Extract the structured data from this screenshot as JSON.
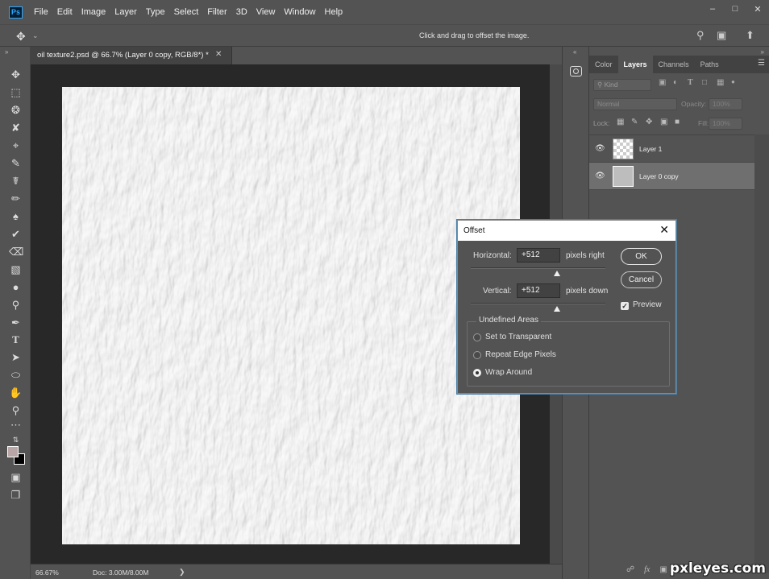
{
  "app": {
    "logo": "Ps"
  },
  "menu": [
    "File",
    "Edit",
    "Image",
    "Layer",
    "Type",
    "Select",
    "Filter",
    "3D",
    "View",
    "Window",
    "Help"
  ],
  "options_bar": {
    "hint": "Click and drag to offset the image."
  },
  "document": {
    "tab_title": "oil texture2.psd @ 66.7% (Layer 0 copy, RGB/8*) *",
    "zoom": "66.67%",
    "doc_size": "Doc: 3.00M/8.00M"
  },
  "panel": {
    "tabs": [
      "Color",
      "Layers",
      "Channels",
      "Paths"
    ],
    "active_tab": "Layers",
    "filter_kind": "Kind",
    "blend_mode": "Normal",
    "opacity_label": "Opacity:",
    "opacity_value": "100%",
    "lock_label": "Lock:",
    "fill_label": "Fill:",
    "fill_value": "100%",
    "layers": [
      {
        "name": "Layer 1",
        "visible": true,
        "selected": false,
        "thumb": "transparent"
      },
      {
        "name": "Layer 0 copy",
        "visible": true,
        "selected": true,
        "thumb": "texture"
      }
    ]
  },
  "dialog": {
    "title": "Offset",
    "horizontal_label": "Horizontal:",
    "horizontal_value": "+512",
    "horizontal_unit": "pixels right",
    "vertical_label": "Vertical:",
    "vertical_value": "+512",
    "vertical_unit": "pixels down",
    "ok_label": "OK",
    "cancel_label": "Cancel",
    "preview_label": "Preview",
    "preview_checked": true,
    "undefined_areas_label": "Undefined Areas",
    "options": [
      "Set to Transparent",
      "Repeat Edge Pixels",
      "Wrap Around"
    ],
    "selected_option": "Wrap Around"
  },
  "watermark": "pxleyes.com",
  "colors": {
    "ui_bg": "#535353",
    "canvas_bg": "#282828",
    "texture": "#d2d2d2"
  }
}
